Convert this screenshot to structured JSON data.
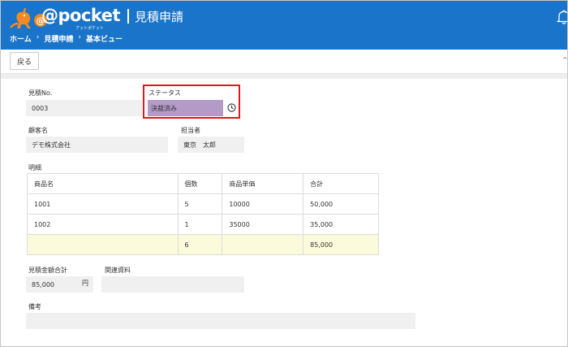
{
  "header": {
    "logo_text": "@pocket",
    "logo_sub": "アットポケット",
    "page_title": "見積申請",
    "breadcrumb": [
      "ホーム",
      "見積申請",
      "基本ビュー"
    ],
    "breadcrumb_sep": "›",
    "bg_color": "#1a74c9"
  },
  "toolbar": {
    "back_label": "戻る",
    "caret": "^"
  },
  "form": {
    "estimate_no_label": "見積No.",
    "estimate_no_value": "0003",
    "status_label": "ステータス",
    "status_value": "決裁済み",
    "status_color": "#b49ac6",
    "status_icon": "clock-icon",
    "customer_label": "顧客名",
    "customer_value": "デモ株式会社",
    "owner_label": "担当者",
    "owner_value": "東京　太郎",
    "detail_label": "明細",
    "total_label": "見積金額合計",
    "total_value": "85,000",
    "total_unit": "円",
    "related_label": "関連資料",
    "related_value": "",
    "remarks_label": "備考",
    "remarks_value": ""
  },
  "detail_table": {
    "headers": [
      "商品名",
      "個数",
      "商品単価",
      "合計"
    ],
    "rows": [
      [
        "1001",
        "5",
        "10000",
        "50,000"
      ],
      [
        "1002",
        "1",
        "35000",
        "35,000"
      ]
    ],
    "total_row": [
      "",
      "6",
      "",
      "85,000"
    ]
  },
  "highlight_color": "#e8141b"
}
